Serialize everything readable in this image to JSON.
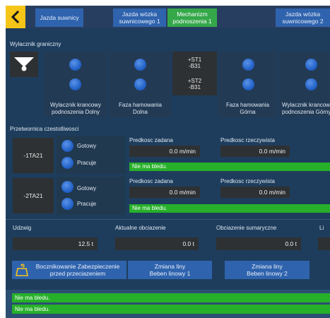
{
  "header": {
    "tabs": [
      {
        "label": "Jazda suwnicy"
      },
      {
        "label": "Jazda wózka\nsuwnicowego 1"
      },
      {
        "label": "Mechanizm\npodnoszenia 1"
      },
      {
        "label": "Jazda wózka\nsuwnicowego 2"
      }
    ],
    "active_color": "#35a84a",
    "accent": "#f5c518"
  },
  "limit_switch": {
    "title": "Wylacznik graniczny",
    "sensor_top": "+ST1\n-B31",
    "sensor_bottom": "+ST2\n-B31",
    "labels": [
      "Wylacznik krancowy\npodnoszenia Dolny",
      "Faza hamowania\nDolna",
      "Faza hamowania\nGórna",
      "Wylacznik krancowy\npodnoszenia Górny"
    ]
  },
  "converter": {
    "title": "Przetwornica czestotliwosci",
    "units": [
      {
        "name": "-1TA21",
        "ready": "Gotowy",
        "working": "Pracuje",
        "set_speed_label": "Predkosc zadana",
        "set_speed": "0.0 m/min",
        "actual_speed_label": "Predkosc rzeczywista",
        "actual_speed": "0.0 m/min",
        "status": "Nie ma bledu."
      },
      {
        "name": "-2TA21",
        "ready": "Gotowy",
        "working": "Pracuje",
        "set_speed_label": "Predkosc zadana",
        "set_speed": "0.0 m/min",
        "actual_speed_label": "Predkosc rzeczywista",
        "actual_speed": "0.0 m/min",
        "status": "Nie ma bledu."
      }
    ]
  },
  "load": {
    "capacity_label": "Udzwig",
    "capacity": "12.5 t",
    "current_label": "Aktualne obciazenie",
    "current": "0.0 t",
    "total_label": "Obciazenie sumaryczne",
    "total": "0.0 t",
    "cut_label": "Li"
  },
  "buttons": {
    "bypass": "Bocznikowanie Zabezpieczenie\nprzed przeciazeniem",
    "rope1": "Zmiana liny\nBeben linowy 1",
    "rope2": "Zmiana liny\nBeben linowy 2"
  },
  "footer": {
    "status1": "Nie ma bledu.",
    "status2": "Nie ma bledu."
  },
  "icons": {
    "back": "chevron-left-icon",
    "limit": "hook-limit-icon",
    "bypass": "hook-load-icon"
  }
}
